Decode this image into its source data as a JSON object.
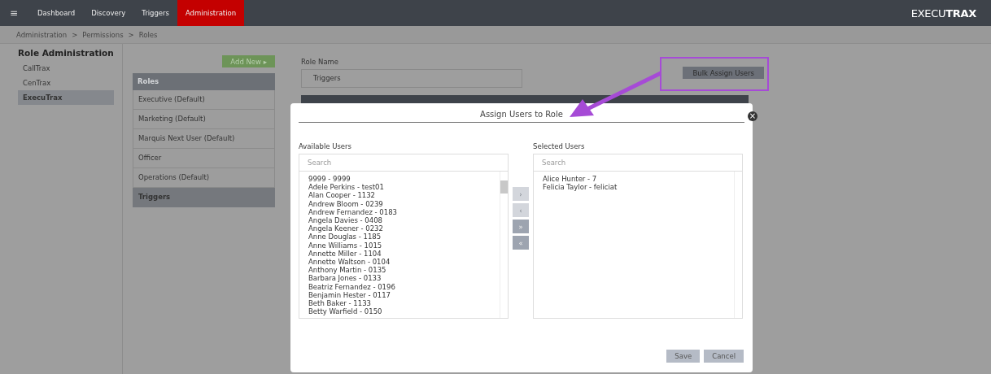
{
  "nav": {
    "menu_icon": "≡",
    "items": [
      {
        "label": "Dashboard",
        "selected": false
      },
      {
        "label": "Discovery",
        "selected": false
      },
      {
        "label": "Triggers",
        "selected": false
      },
      {
        "label": "Administration",
        "selected": true
      }
    ],
    "logo": "EXECU**TRAX**"
  },
  "breadcrumb": [
    "Administration",
    ">",
    "Permissions",
    ">",
    "Roles"
  ],
  "sidebar": {
    "title": "Role Administration",
    "items": [
      {
        "label": "CallTrax",
        "selected": false
      },
      {
        "label": "CenTrax",
        "selected": false
      },
      {
        "label": "ExecuTrax",
        "selected": true
      }
    ]
  },
  "roles": {
    "add_button": "Add New ▸",
    "header": "Roles",
    "items": [
      {
        "label": "Executive (Default)",
        "selected": false
      },
      {
        "label": "Marketing (Default)",
        "selected": false
      },
      {
        "label": "Marquis Next User (Default)",
        "selected": false
      },
      {
        "label": "Officer",
        "selected": false
      },
      {
        "label": "Operations (Default)",
        "selected": false
      },
      {
        "label": "Triggers",
        "selected": true
      }
    ]
  },
  "role_form": {
    "label": "Role Name",
    "value": "Triggers",
    "bulk_button": "Bulk Assign Users"
  },
  "modal": {
    "title": "Assign Users to Role",
    "close": "×",
    "available": {
      "label": "Available Users",
      "placeholder": "Search",
      "users": [
        "9999 - 9999",
        "Adele Perkins - test01",
        "Alan Cooper - 1132",
        "Andrew Bloom - 0239",
        "Andrew Fernandez - 0183",
        "Angela Davies - 0408",
        "Angela Keener - 0232",
        "Anne Douglas - 1185",
        "Anne Williams - 1015",
        "Annette Miller - 1104",
        "Annette Waltson - 0104",
        "Anthony Martin - 0135",
        "Barbara Jones - 0133",
        "Beatriz Fernandez - 0196",
        "Benjamin Hester - 0117",
        "Beth Baker - 1133",
        "Betty Warfield - 0150"
      ]
    },
    "move_buttons": [
      {
        "label": "›",
        "disabled": true
      },
      {
        "label": "‹",
        "disabled": true
      },
      {
        "label": "»",
        "disabled": false
      },
      {
        "label": "«",
        "disabled": false
      }
    ],
    "selected": {
      "label": "Selected Users",
      "placeholder": "Search",
      "users": [
        "Alice Hunter - 7",
        "Felicia Taylor - feliciat"
      ]
    },
    "buttons": [
      "Save",
      "Cancel"
    ]
  }
}
